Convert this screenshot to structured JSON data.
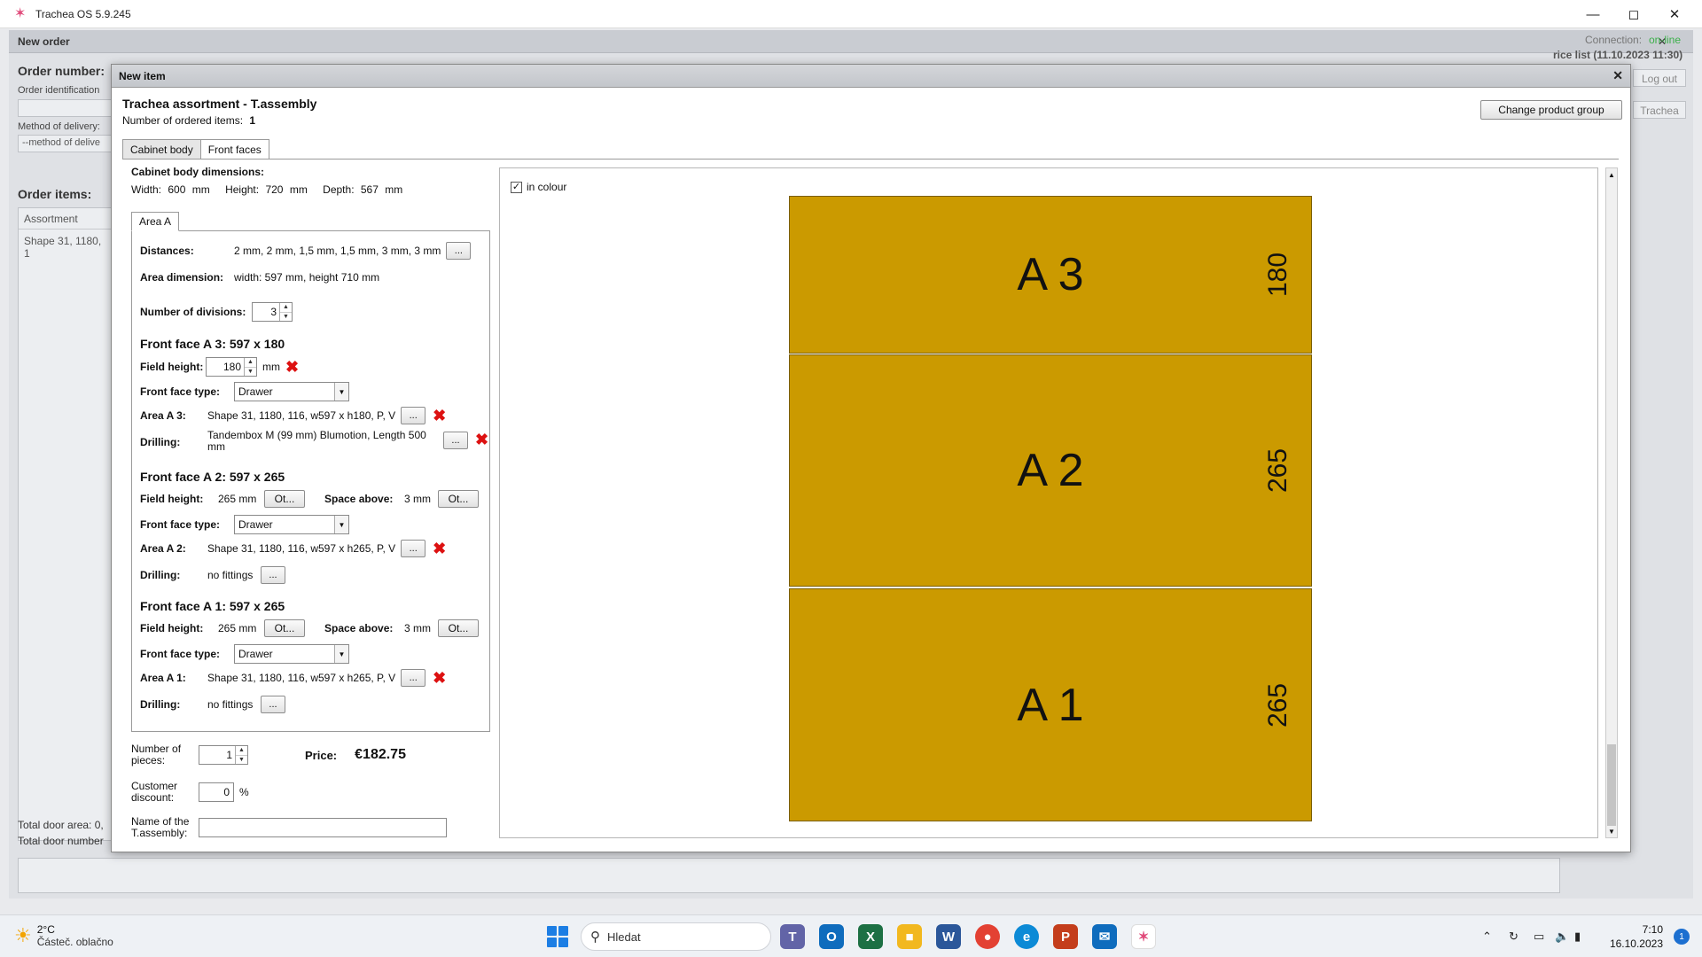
{
  "window": {
    "title": "Trachea OS 5.9.245"
  },
  "background": {
    "header": "New order",
    "order_number_label": "Order number:",
    "order_identification_label": "Order identification",
    "method_label": "Method of delivery:",
    "method_placeholder": "--method of delive",
    "order_items_label": "Order items:",
    "assortment_header": "Assortment",
    "assortment_row": "Shape 31, 1180, 1",
    "connection_label": "Connection:",
    "connection_status": "on-line",
    "price_list": "rice list (11.10.2023 11:30)",
    "logout": "Log out",
    "trachea": "Trachea",
    "total_area": "Total door area: 0,",
    "total_number": "Total door number"
  },
  "dialog": {
    "title": "New item",
    "header_title": "Trachea assortment - T.assembly",
    "count_label": "Number of ordered items:",
    "count_value": "1",
    "change_group": "Change product group",
    "tabs": [
      "Cabinet body",
      "Front faces"
    ],
    "cabinet": {
      "title": "Cabinet body dimensions:",
      "width_label": "Width:",
      "width": "600",
      "height_label": "Height:",
      "height": "720",
      "depth_label": "Depth:",
      "depth": "567",
      "unit": "mm"
    },
    "area_tab": "Area A",
    "distances_label": "Distances:",
    "distances_value": "2 mm, 2 mm, 1,5 mm, 1,5 mm, 3 mm, 3 mm",
    "area_dim_label": "Area dimension:",
    "area_dim_value": "width: 597 mm, height 710 mm",
    "divisions_label": "Number of divisions:",
    "divisions_value": "3",
    "faces": [
      {
        "title": "Front face A 3: 597 x 180",
        "field_height_label": "Field height:",
        "field_height": "180",
        "unit": "mm",
        "type_label": "Front face type:",
        "type": "Drawer",
        "area_label": "Area A 3:",
        "area_value": "Shape 31, 1180, 116, w597 x h180, P, V",
        "drilling_label": "Drilling:",
        "drilling_value": "Tandembox M (99 mm) Blumotion, Length 500 mm"
      },
      {
        "title": "Front face A 2: 597 x 265",
        "field_height_label": "Field height:",
        "field_height": "265 mm",
        "other": "Ot...",
        "space_label": "Space above:",
        "space": "3 mm",
        "type_label": "Front face type:",
        "type": "Drawer",
        "area_label": "Area A 2:",
        "area_value": "Shape 31, 1180, 116, w597 x h265, P, V",
        "drilling_label": "Drilling:",
        "drilling_value": "no fittings"
      },
      {
        "title": "Front face A 1: 597 x 265",
        "field_height_label": "Field height:",
        "field_height": "265 mm",
        "other": "Ot...",
        "space_label": "Space above:",
        "space": "3 mm",
        "type_label": "Front face type:",
        "type": "Drawer",
        "area_label": "Area A 1:",
        "area_value": "Shape 31, 1180, 116, w597 x h265, P, V",
        "drilling_label": "Drilling:",
        "drilling_value": "no fittings"
      }
    ],
    "ellipsis": "...",
    "pieces_label": "Number of pieces:",
    "pieces_value": "1",
    "price_label": "Price:",
    "price_value": "€182.75",
    "discount_label": "Customer discount:",
    "discount_value": "0",
    "percent": "%",
    "name_label": "Name of the T.assembly:",
    "name_value": ""
  },
  "preview": {
    "in_colour_label": "in colour",
    "in_colour_checked": true,
    "front_color": "#cb9a00",
    "fronts": [
      {
        "code": "A 3",
        "height": "180"
      },
      {
        "code": "A 2",
        "height": "265"
      },
      {
        "code": "A 1",
        "height": "265"
      }
    ]
  },
  "taskbar": {
    "temperature": "2°C",
    "weather": "Částeč. oblačno",
    "search_placeholder": "Hledat",
    "time": "7:10",
    "date": "16.10.2023",
    "notifications": "1"
  }
}
